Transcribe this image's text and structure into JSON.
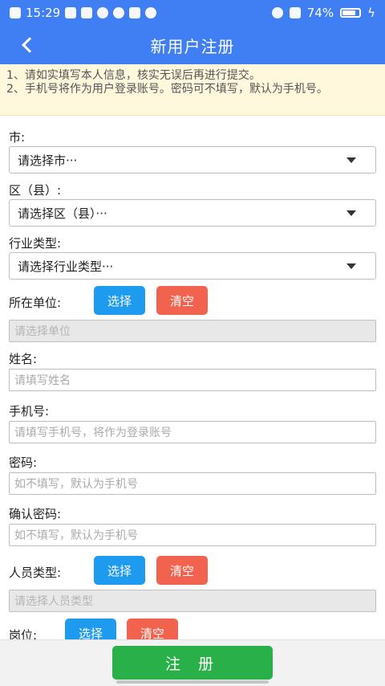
{
  "status": {
    "time": "15:29",
    "battery": "74%",
    "battery_level": 0.74
  },
  "header": {
    "title": "新用户注册"
  },
  "notice": {
    "line1": "1、请如实填写本人信息，核实无误后再进行提交。",
    "line2": "2、手机号将作为用户登录账号。密码可不填写，默认为手机号。"
  },
  "form": {
    "city": {
      "label": "市:",
      "value": "请选择市···"
    },
    "district": {
      "label": "区（县）:",
      "value": "请选择区（县）···"
    },
    "industry": {
      "label": "行业类型:",
      "value": "请选择行业类型···"
    },
    "unit": {
      "label": "所在单位:",
      "select": "选择",
      "clear": "清空",
      "placeholder": "请选择单位"
    },
    "name": {
      "label": "姓名:",
      "placeholder": "请填写姓名"
    },
    "phone": {
      "label": "手机号:",
      "placeholder": "请填写手机号，将作为登录账号"
    },
    "password": {
      "label": "密码:",
      "placeholder": "如不填写，默认为手机号"
    },
    "confirm": {
      "label": "确认密码:",
      "placeholder": "如不填写，默认为手机号"
    },
    "persontype": {
      "label": "人员类型:",
      "select": "选择",
      "clear": "清空",
      "placeholder": "请选择人员类型"
    },
    "post": {
      "label": "岗位:",
      "select": "选择",
      "clear": "清空"
    }
  },
  "footer": {
    "submit": "注 册"
  },
  "colors": {
    "primary": "#3f7ef3",
    "select_btn": "#1e9bef",
    "clear_btn": "#f1634e",
    "submit_btn": "#2ab048",
    "notice_bg": "#fff8dd"
  }
}
